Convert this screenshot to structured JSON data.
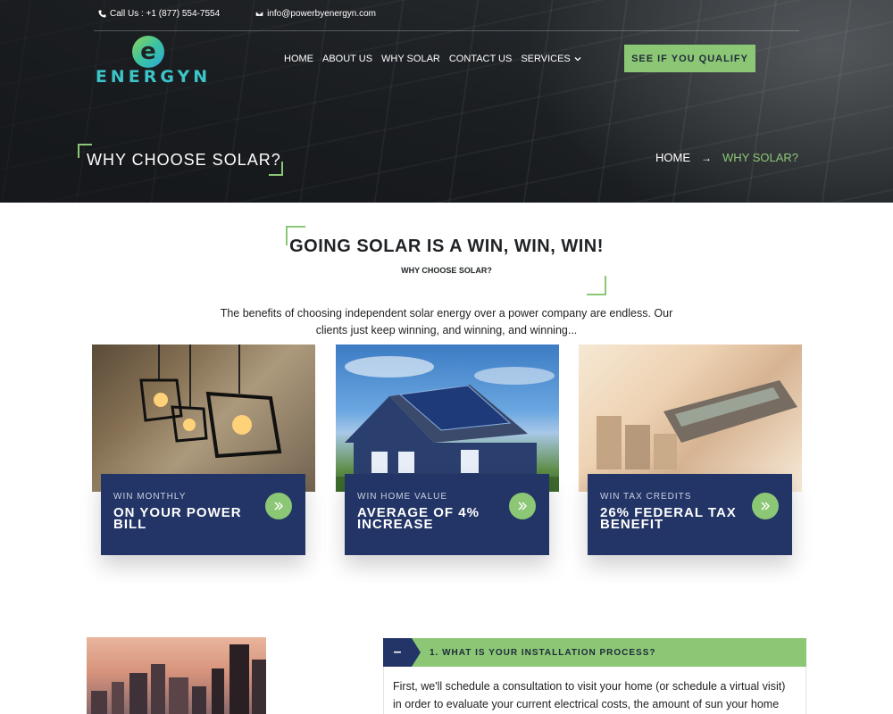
{
  "topbar": {
    "phone": "Call Us : +1 (877) 554-7554",
    "email": "info@powerbyenergyn.com"
  },
  "brand": {
    "mark": "e",
    "name": "ENERGYN",
    "colors": {
      "accent_green": "#8cc776",
      "navy": "#233566",
      "teal": "#3cc4c8"
    }
  },
  "nav": {
    "items": [
      "HOME",
      "ABOUT US",
      "WHY SOLAR",
      "CONTACT US",
      "SERVICES"
    ],
    "cta": "SEE IF YOU QUALIFY"
  },
  "hero": {
    "title": "WHY CHOOSE SOLAR?",
    "breadcrumb": {
      "home": "HOME",
      "separator": "→",
      "current": "WHY SOLAR?"
    }
  },
  "intro": {
    "heading": "GOING SOLAR IS A WIN, WIN, WIN!",
    "subheading": "WHY CHOOSE SOLAR?",
    "body": "The benefits of choosing independent solar energy over a power company are endless. Our clients just keep winning, and winning, and winning..."
  },
  "cards": [
    {
      "kicker": "WIN MONTHLY",
      "headline": "ON YOUR POWER BILL",
      "icon": "double-chevron-right-icon"
    },
    {
      "kicker": "WIN HOME VALUE",
      "headline": "AVERAGE OF 4% INCREASE",
      "icon": "double-chevron-right-icon"
    },
    {
      "kicker": "WIN TAX CREDITS",
      "headline": "26% FEDERAL TAX BENEFIT",
      "icon": "double-chevron-right-icon"
    }
  ],
  "faq": {
    "toggle": "–",
    "title": "1. WHAT IS YOUR INSTALLATION PROCESS?",
    "body": "First, we'll schedule a consultation to visit your home (or schedule a virtual visit) in order to evaluate your current electrical costs, the amount of sun your home"
  }
}
